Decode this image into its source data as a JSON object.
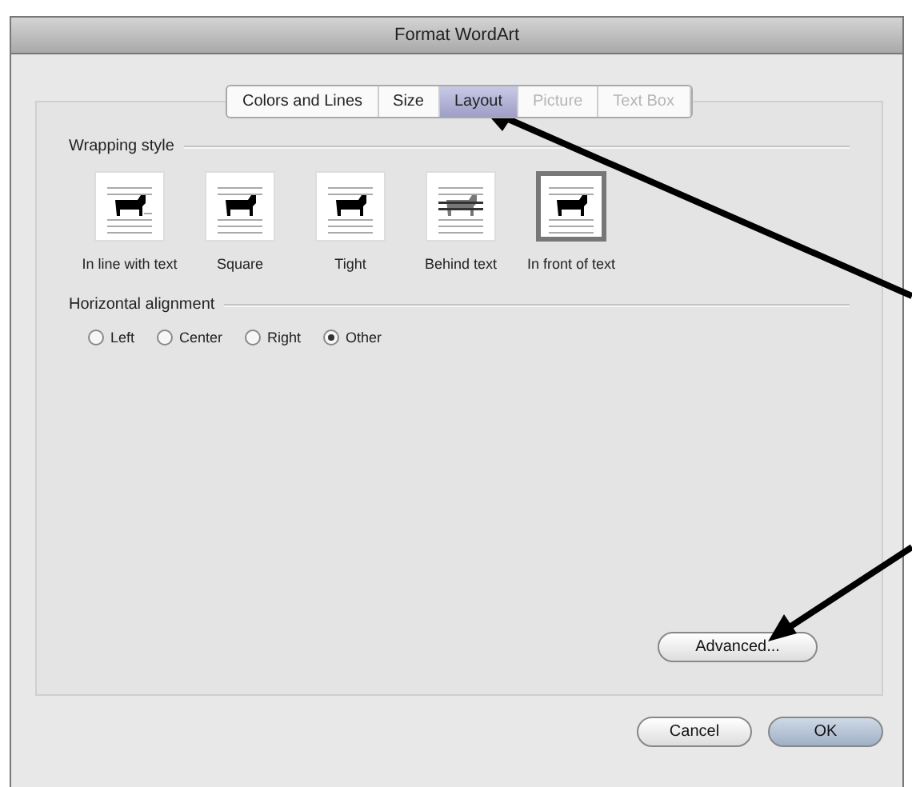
{
  "window": {
    "title": "Format WordArt"
  },
  "tabs": [
    {
      "label": "Colors and Lines",
      "selected": false,
      "disabled": false
    },
    {
      "label": "Size",
      "selected": false,
      "disabled": false
    },
    {
      "label": "Layout",
      "selected": true,
      "disabled": false
    },
    {
      "label": "Picture",
      "selected": false,
      "disabled": true
    },
    {
      "label": "Text Box",
      "selected": false,
      "disabled": true
    }
  ],
  "wrapping_style": {
    "heading": "Wrapping style",
    "options": [
      {
        "label": "In line with text",
        "kind": "inline",
        "selected": false
      },
      {
        "label": "Square",
        "kind": "square",
        "selected": false
      },
      {
        "label": "Tight",
        "kind": "tight",
        "selected": false
      },
      {
        "label": "Behind text",
        "kind": "behind",
        "selected": false
      },
      {
        "label": "In front of text",
        "kind": "front",
        "selected": true
      }
    ]
  },
  "horizontal_alignment": {
    "heading": "Horizontal alignment",
    "options": [
      {
        "label": "Left",
        "selected": false
      },
      {
        "label": "Center",
        "selected": false
      },
      {
        "label": "Right",
        "selected": false
      },
      {
        "label": "Other",
        "selected": true
      }
    ]
  },
  "advanced_button": "Advanced...",
  "buttons": [
    {
      "label": "Cancel",
      "kind": "cancel"
    },
    {
      "label": "OK",
      "kind": "default"
    }
  ]
}
